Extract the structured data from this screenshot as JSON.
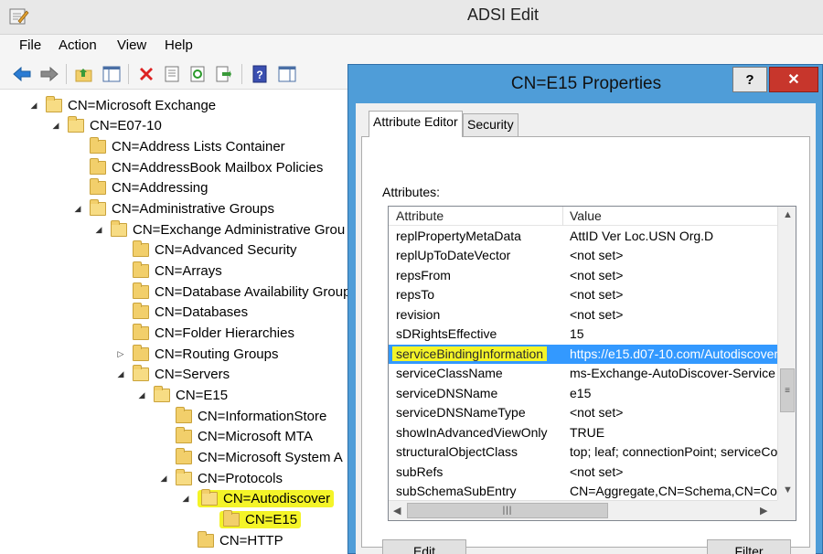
{
  "window": {
    "title": "ADSI Edit"
  },
  "menu": {
    "file": "File",
    "action": "Action",
    "view": "View",
    "help": "Help"
  },
  "tree": {
    "items": [
      {
        "label": "CN=Microsoft Exchange",
        "expander": "◢"
      },
      {
        "label": "CN=E07-10",
        "expander": "◢"
      },
      {
        "label": "CN=Address Lists Container",
        "expander": ""
      },
      {
        "label": "CN=AddressBook Mailbox Policies",
        "expander": ""
      },
      {
        "label": "CN=Addressing",
        "expander": ""
      },
      {
        "label": "CN=Administrative Groups",
        "expander": "◢"
      },
      {
        "label": "CN=Exchange Administrative Grou",
        "expander": "◢"
      },
      {
        "label": "CN=Advanced Security",
        "expander": ""
      },
      {
        "label": "CN=Arrays",
        "expander": ""
      },
      {
        "label": "CN=Database Availability Group",
        "expander": ""
      },
      {
        "label": "CN=Databases",
        "expander": ""
      },
      {
        "label": "CN=Folder Hierarchies",
        "expander": ""
      },
      {
        "label": "CN=Routing Groups",
        "expander": "▷"
      },
      {
        "label": "CN=Servers",
        "expander": "◢"
      },
      {
        "label": "CN=E15",
        "expander": "◢"
      },
      {
        "label": "CN=InformationStore",
        "expander": ""
      },
      {
        "label": "CN=Microsoft MTA",
        "expander": ""
      },
      {
        "label": "CN=Microsoft System A",
        "expander": ""
      },
      {
        "label": "CN=Protocols",
        "expander": "◢"
      },
      {
        "label": "CN=Autodiscover",
        "expander": "◢"
      },
      {
        "label": "CN=E15",
        "expander": ""
      },
      {
        "label": "CN=HTTP",
        "expander": ""
      }
    ]
  },
  "dialog": {
    "title": "CN=E15 Properties",
    "help_label": "?",
    "close_label": "✕",
    "tabs": {
      "attribute_editor": "Attribute Editor",
      "security": "Security"
    },
    "attributes_label": "Attributes:",
    "columns": {
      "attribute": "Attribute",
      "value": "Value"
    },
    "rows": [
      {
        "attribute": "replPropertyMetaData",
        "value": "AttID  Ver     Loc.USN              Org.D"
      },
      {
        "attribute": "replUpToDateVector",
        "value": "<not set>"
      },
      {
        "attribute": "repsFrom",
        "value": "<not set>"
      },
      {
        "attribute": "repsTo",
        "value": "<not set>"
      },
      {
        "attribute": "revision",
        "value": "<not set>"
      },
      {
        "attribute": "sDRightsEffective",
        "value": "15"
      },
      {
        "attribute": "serviceBindingInformation",
        "value": "https://e15.d07-10.com/Autodiscover"
      },
      {
        "attribute": "serviceClassName",
        "value": "ms-Exchange-AutoDiscover-Service"
      },
      {
        "attribute": "serviceDNSName",
        "value": "e15"
      },
      {
        "attribute": "serviceDNSNameType",
        "value": "<not set>"
      },
      {
        "attribute": "showInAdvancedViewOnly",
        "value": "TRUE"
      },
      {
        "attribute": "structuralObjectClass",
        "value": "top; leaf; connectionPoint; serviceCon"
      },
      {
        "attribute": "subRefs",
        "value": "<not set>"
      },
      {
        "attribute": "subSchemaSubEntry",
        "value": "CN=Aggregate,CN=Schema,CN=Confi"
      }
    ],
    "edit_label": "Edit",
    "filter_label": "Filter"
  },
  "colors": {
    "dialog_frame": "#4f9dd8",
    "selection": "#3399ff",
    "highlight": "#f4f428",
    "close": "#c7362c"
  }
}
